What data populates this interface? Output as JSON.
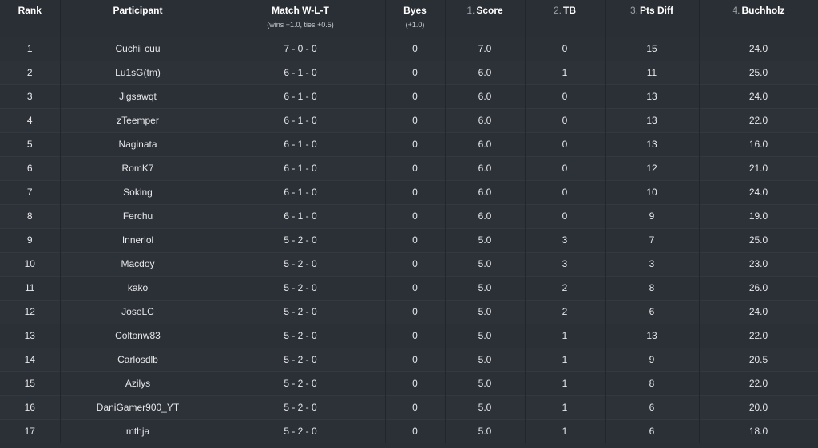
{
  "headers": {
    "rank": "Rank",
    "participant": "Participant",
    "match": "Match W-L-T",
    "match_sub": "(wins +1.0, ties +0.5)",
    "byes": "Byes",
    "byes_sub": "(+1.0)",
    "score_num": "1.",
    "score": "Score",
    "tb_num": "2.",
    "tb": "TB",
    "pts_num": "3.",
    "pts": "Pts Diff",
    "buch_num": "4.",
    "buch": "Buchholz"
  },
  "rows": [
    {
      "rank": "1",
      "participant": "Cuchii cuu",
      "match": "7 - 0 - 0",
      "byes": "0",
      "score": "7.0",
      "tb": "0",
      "pts": "15",
      "buch": "24.0"
    },
    {
      "rank": "2",
      "participant": "Lu1sG(tm)",
      "match": "6 - 1 - 0",
      "byes": "0",
      "score": "6.0",
      "tb": "1",
      "pts": "11",
      "buch": "25.0"
    },
    {
      "rank": "3",
      "participant": "Jigsawqt",
      "match": "6 - 1 - 0",
      "byes": "0",
      "score": "6.0",
      "tb": "0",
      "pts": "13",
      "buch": "24.0"
    },
    {
      "rank": "4",
      "participant": "zTeemper",
      "match": "6 - 1 - 0",
      "byes": "0",
      "score": "6.0",
      "tb": "0",
      "pts": "13",
      "buch": "22.0"
    },
    {
      "rank": "5",
      "participant": "Naginata",
      "match": "6 - 1 - 0",
      "byes": "0",
      "score": "6.0",
      "tb": "0",
      "pts": "13",
      "buch": "16.0"
    },
    {
      "rank": "6",
      "participant": "RomK7",
      "match": "6 - 1 - 0",
      "byes": "0",
      "score": "6.0",
      "tb": "0",
      "pts": "12",
      "buch": "21.0"
    },
    {
      "rank": "7",
      "participant": "Soking",
      "match": "6 - 1 - 0",
      "byes": "0",
      "score": "6.0",
      "tb": "0",
      "pts": "10",
      "buch": "24.0"
    },
    {
      "rank": "8",
      "participant": "Ferchu",
      "match": "6 - 1 - 0",
      "byes": "0",
      "score": "6.0",
      "tb": "0",
      "pts": "9",
      "buch": "19.0"
    },
    {
      "rank": "9",
      "participant": "Innerlol",
      "match": "5 - 2 - 0",
      "byes": "0",
      "score": "5.0",
      "tb": "3",
      "pts": "7",
      "buch": "25.0"
    },
    {
      "rank": "10",
      "participant": "Macdoy",
      "match": "5 - 2 - 0",
      "byes": "0",
      "score": "5.0",
      "tb": "3",
      "pts": "3",
      "buch": "23.0"
    },
    {
      "rank": "11",
      "participant": "kako",
      "match": "5 - 2 - 0",
      "byes": "0",
      "score": "5.0",
      "tb": "2",
      "pts": "8",
      "buch": "26.0"
    },
    {
      "rank": "12",
      "participant": "JoseLC",
      "match": "5 - 2 - 0",
      "byes": "0",
      "score": "5.0",
      "tb": "2",
      "pts": "6",
      "buch": "24.0"
    },
    {
      "rank": "13",
      "participant": "Coltonw83",
      "match": "5 - 2 - 0",
      "byes": "0",
      "score": "5.0",
      "tb": "1",
      "pts": "13",
      "buch": "22.0"
    },
    {
      "rank": "14",
      "participant": "Carlosdlb",
      "match": "5 - 2 - 0",
      "byes": "0",
      "score": "5.0",
      "tb": "1",
      "pts": "9",
      "buch": "20.5"
    },
    {
      "rank": "15",
      "participant": "Azilys",
      "match": "5 - 2 - 0",
      "byes": "0",
      "score": "5.0",
      "tb": "1",
      "pts": "8",
      "buch": "22.0"
    },
    {
      "rank": "16",
      "participant": "DaniGamer900_YT",
      "match": "5 - 2 - 0",
      "byes": "0",
      "score": "5.0",
      "tb": "1",
      "pts": "6",
      "buch": "20.0"
    },
    {
      "rank": "17",
      "participant": "mthja",
      "match": "5 - 2 - 0",
      "byes": "0",
      "score": "5.0",
      "tb": "1",
      "pts": "6",
      "buch": "18.0"
    }
  ]
}
